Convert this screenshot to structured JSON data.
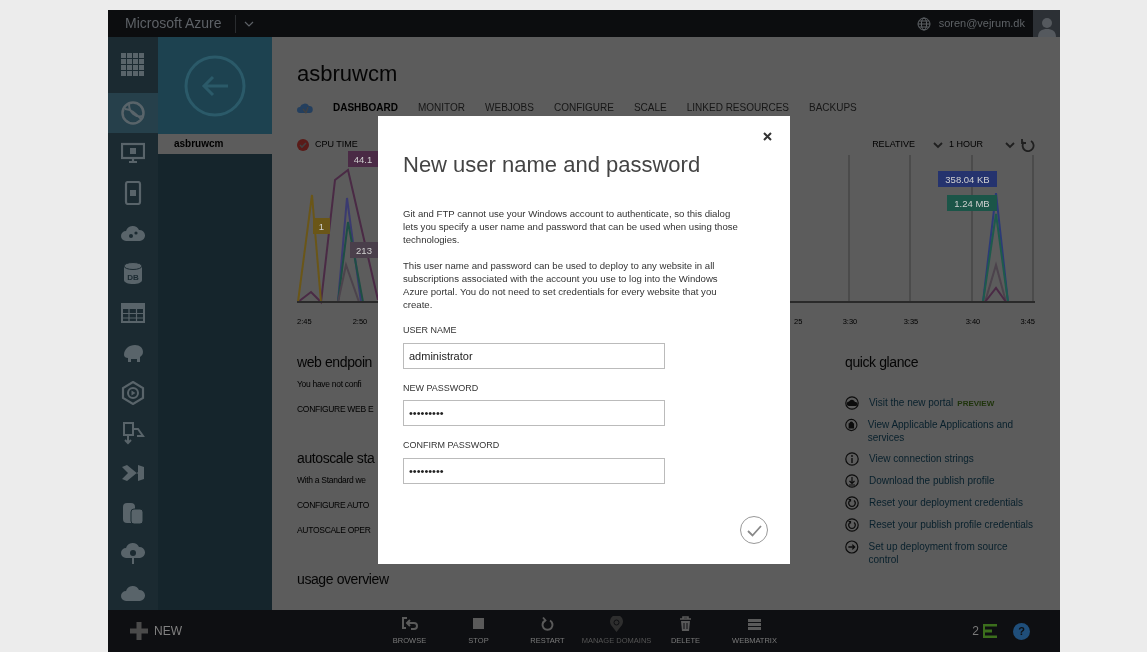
{
  "top_bar": {
    "brand": "Microsoft Azure",
    "user_email": "soren@vejrum.dk"
  },
  "sidebar": {
    "items": [
      {
        "selected": false
      },
      {
        "selected": true
      },
      {
        "selected": false
      },
      {
        "selected": false
      },
      {
        "selected": false
      },
      {
        "selected": false,
        "text": "DB"
      },
      {
        "selected": false
      },
      {
        "selected": false
      },
      {
        "selected": false
      },
      {
        "selected": false
      },
      {
        "selected": false
      },
      {
        "selected": false
      },
      {
        "selected": false
      },
      {
        "selected": false
      }
    ]
  },
  "panel": {
    "items": [
      {
        "label": "asbruwcm",
        "selected": true
      }
    ]
  },
  "page": {
    "title": "asbruwcm",
    "tabs": [
      {
        "label": "DASHBOARD",
        "selected": true
      },
      {
        "label": "MONITOR",
        "selected": false
      },
      {
        "label": "WEBJOBS",
        "selected": false
      },
      {
        "label": "CONFIGURE",
        "selected": false
      },
      {
        "label": "SCALE",
        "selected": false
      },
      {
        "label": "LINKED RESOURCES",
        "selected": false
      },
      {
        "label": "BACKUPS",
        "selected": false
      }
    ],
    "chart": {
      "legend": "CPU TIME",
      "range_mode": "RELATIVE",
      "range": "1 HOUR",
      "tooltips": [
        {
          "text": "44.1",
          "color": "#4a2a45"
        },
        {
          "text": "1",
          "color": "#6a5618"
        },
        {
          "text": "213",
          "color": "#4a3f4b"
        },
        {
          "text": "358.04 KB",
          "color": "#25336e"
        },
        {
          "text": "1.24 MB",
          "color": "#1b5548"
        }
      ],
      "x_tick_labels": [
        "2:45",
        "2:50",
        "25",
        "3:30",
        "3:35",
        "3:40",
        "3:45"
      ]
    },
    "sections": [
      {
        "heading": "web endpoin",
        "lines": [
          "You have not confi",
          "CONFIGURE WEB E"
        ]
      },
      {
        "heading": "autoscale sta",
        "lines": [
          "With a Standard we",
          "CONFIGURE AUTO",
          "AUTOSCALE OPER"
        ]
      },
      {
        "heading": "usage overview"
      }
    ],
    "quick_glance": {
      "heading": "quick glance",
      "links": [
        {
          "text": "Visit the new portal",
          "tag": "PREVIEW"
        },
        {
          "text": "View Applicable Applications and services"
        },
        {
          "text": "View connection strings"
        },
        {
          "text": "Download the publish profile"
        },
        {
          "text": "Reset your deployment credentials"
        },
        {
          "text": "Reset your publish profile credentials"
        },
        {
          "text": "Set up deployment from source control"
        }
      ]
    }
  },
  "dialog": {
    "title": "New user name and password",
    "paragraphs": [
      "Git and FTP cannot use your Windows account to authenticate, so this dialog lets you specify a user name and password that can be used when using those technologies.",
      "This user name and password can be used to deploy to any website in all subscriptions associated with the account you use to log into the Windows Azure portal. You do not need to set credentials for every website that you create."
    ],
    "fields": [
      {
        "label": "USER NAME",
        "value": "administrator"
      },
      {
        "label": "NEW PASSWORD",
        "value": "•••••••••"
      },
      {
        "label": "CONFIRM PASSWORD",
        "value": "•••••••••"
      }
    ]
  },
  "command_bar": {
    "new_label": "NEW",
    "commands": [
      {
        "label": "BROWSE",
        "disabled": false
      },
      {
        "label": "STOP",
        "disabled": false
      },
      {
        "label": "RESTART",
        "disabled": false
      },
      {
        "label": "MANAGE DOMAINS",
        "disabled": true
      },
      {
        "label": "DELETE",
        "disabled": false
      },
      {
        "label": "WEBMATRIX",
        "disabled": false
      }
    ],
    "notification_count": "2",
    "help_label": "?"
  }
}
